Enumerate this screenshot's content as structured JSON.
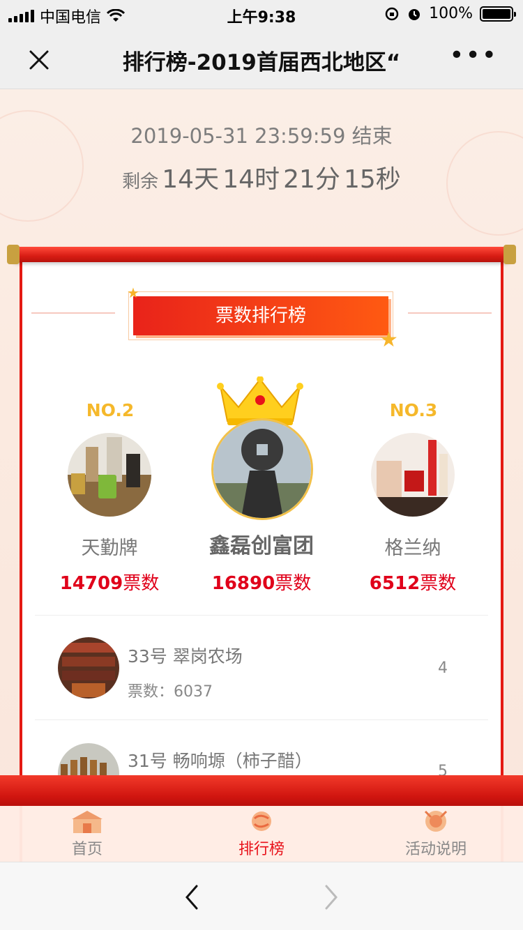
{
  "status_bar": {
    "carrier": "中国电信",
    "time": "上午9:38",
    "battery": "100%"
  },
  "nav": {
    "title": "排行榜-2019首届西北地区“"
  },
  "countdown": {
    "end_text": "2019-05-31 23:59:59 结束",
    "remain_label": "剩余",
    "days": "14天",
    "hours": "14时",
    "minutes": "21分",
    "seconds": "15秒"
  },
  "board": {
    "title": "票数排行榜",
    "podium": [
      {
        "rank_label": "",
        "name": "鑫磊创富团",
        "votes": "16890",
        "unit": "票数"
      },
      {
        "rank_label": "NO.2",
        "name": "天勤牌",
        "votes": "14709",
        "unit": "票数"
      },
      {
        "rank_label": "NO.3",
        "name": "格兰纳",
        "votes": "6512",
        "unit": "票数"
      }
    ],
    "list": [
      {
        "title": "33号 翠岗农场",
        "votes": "票数：6037",
        "rank": "4"
      },
      {
        "title": "31号 畅响塬（柿子醋）",
        "votes": "",
        "rank": "5"
      }
    ]
  },
  "tabs": [
    {
      "label": "首页",
      "icon": "home-gate-icon",
      "active": false
    },
    {
      "label": "排行榜",
      "icon": "ranking-icon",
      "active": true
    },
    {
      "label": "活动说明",
      "icon": "drum-icon",
      "active": false
    }
  ],
  "colors": {
    "accent": "#e8121a",
    "gold": "#f5b82b",
    "board_border": "#e41a13"
  }
}
